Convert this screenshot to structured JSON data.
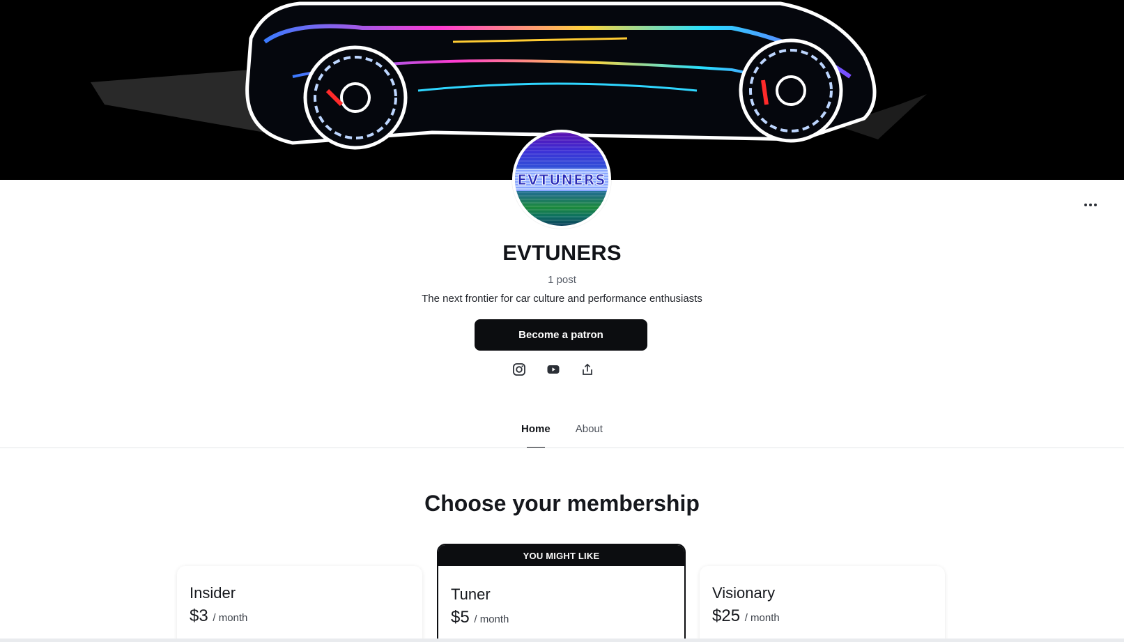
{
  "creator": {
    "name": "EVTUNERS",
    "post_count": "1 post",
    "tagline": "The next frontier for car culture and performance enthusiasts",
    "avatar_text": "EVTUNERS"
  },
  "actions": {
    "become_patron": "Become a patron",
    "more": "more-options"
  },
  "social": {
    "icons": [
      "instagram-icon",
      "youtube-icon",
      "share-icon"
    ]
  },
  "tabs": [
    {
      "label": "Home",
      "active": true
    },
    {
      "label": "About",
      "active": false
    }
  ],
  "membership": {
    "title": "Choose your membership",
    "featured_badge": "YOU MIGHT LIKE",
    "tiers": [
      {
        "name": "Insider",
        "price": "$3",
        "period": "/ month"
      },
      {
        "name": "Tuner",
        "price": "$5",
        "period": "/ month"
      },
      {
        "name": "Visionary",
        "price": "$25",
        "period": "/ month"
      }
    ]
  },
  "colors": {
    "button_bg": "#0c0d10",
    "text": "#111318",
    "cover_bg": "#000000"
  }
}
